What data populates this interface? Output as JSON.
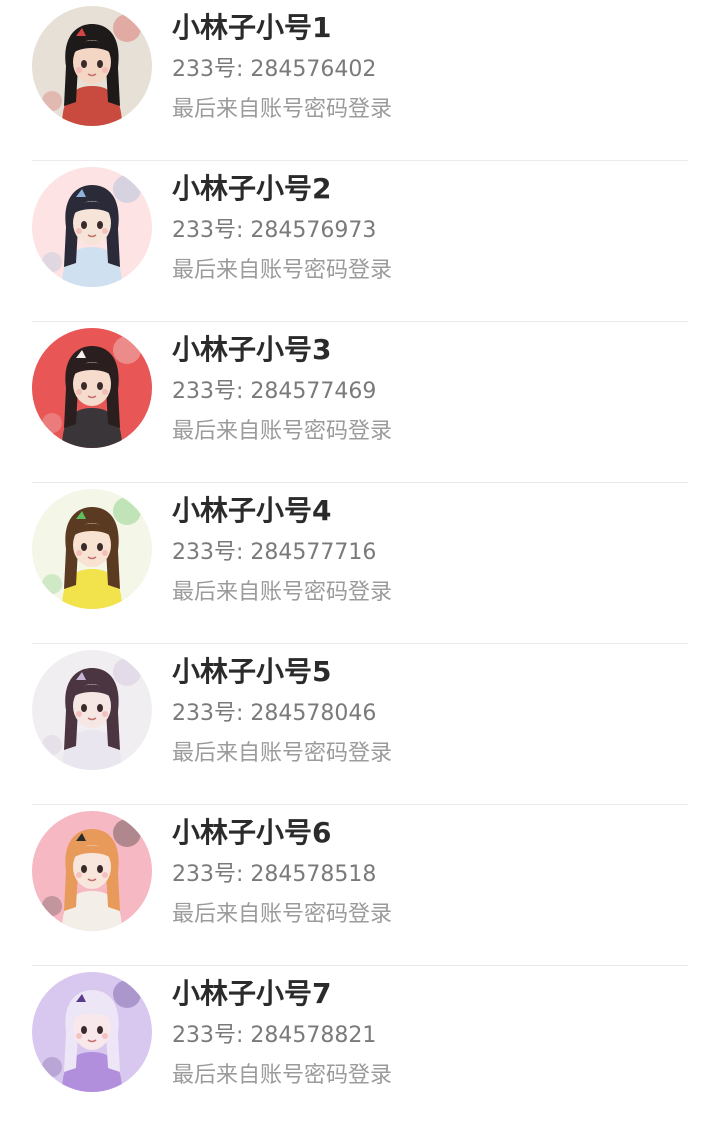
{
  "accounts": [
    {
      "name": "小林子小号1",
      "id_label": "233号: 284576402",
      "login_text": "最后来自账号密码登录",
      "avatar": {
        "bg": "#e6e0d6",
        "hair": "#1f1a1a",
        "accent": "#d64545",
        "skin": "#f4d6c4",
        "outfit": "#c94b3f"
      }
    },
    {
      "name": "小林子小号2",
      "id_label": "233号: 284576973",
      "login_text": "最后来自账号密码登录",
      "avatar": {
        "bg": "#fde3e3",
        "hair": "#2a2a38",
        "accent": "#8fb3d9",
        "skin": "#f7e4d8",
        "outfit": "#cfe0f0"
      }
    },
    {
      "name": "小林子小号3",
      "id_label": "233号: 284577469",
      "login_text": "最后来自账号密码登录",
      "avatar": {
        "bg": "#e85656",
        "hair": "#2a1e1e",
        "accent": "#f4f0ea",
        "skin": "#f6dccd",
        "outfit": "#3a3538"
      }
    },
    {
      "name": "小林子小号4",
      "id_label": "233号: 284577716",
      "login_text": "最后来自账号密码登录",
      "avatar": {
        "bg": "#f4f6e8",
        "hair": "#5b3a22",
        "accent": "#5fbf5f",
        "skin": "#f8e2d2",
        "outfit": "#f2e24c"
      }
    },
    {
      "name": "小林子小号5",
      "id_label": "233号: 284578046",
      "login_text": "最后来自账号密码登录",
      "avatar": {
        "bg": "#f1eef2",
        "hair": "#4a3540",
        "accent": "#c9b6d6",
        "skin": "#f6e6e4",
        "outfit": "#e9e6f0"
      }
    },
    {
      "name": "小林子小号6",
      "id_label": "233号: 284578518",
      "login_text": "最后来自账号密码登录",
      "avatar": {
        "bg": "#f6b8c2",
        "hair": "#e89a5a",
        "accent": "#2a2a2a",
        "skin": "#f8e6dc",
        "outfit": "#f3efe8"
      }
    },
    {
      "name": "小林子小号7",
      "id_label": "233号: 284578821",
      "login_text": "最后来自账号密码登录",
      "avatar": {
        "bg": "#d8c8ef",
        "hair": "#ece6f6",
        "accent": "#5a3d8c",
        "skin": "#f8e8ec",
        "outfit": "#b28fdd"
      }
    }
  ]
}
